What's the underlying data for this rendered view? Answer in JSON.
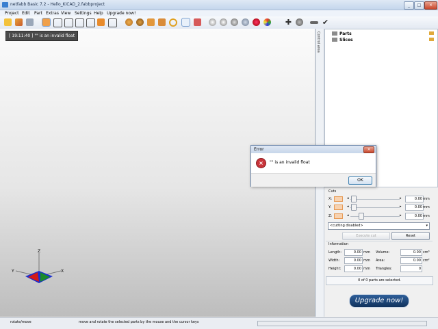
{
  "window": {
    "title": "netfabb Basic 7.2 - Hello_KiCAD_2.fabbproject",
    "controls": [
      "_",
      "□",
      "×"
    ]
  },
  "menu": [
    "Project",
    "Edit",
    "Part",
    "Extras",
    "View",
    "Settings",
    "Help",
    "Upgrade now!"
  ],
  "toolbar": {
    "icons": [
      "open-folder-icon",
      "open-part-icon",
      "save-icon",
      "view-cube-1-icon",
      "view-cube-2-icon",
      "view-cube-3-icon",
      "view-cube-4-icon",
      "view-cube-5-icon",
      "view-cube-6-icon",
      "view-cube-7-icon",
      "repair-icon",
      "measure-icon",
      "box-icon",
      "box-2-icon",
      "zoom-icon",
      "select-arrow-icon",
      "rotate-icon",
      "shading-1-icon",
      "shading-2-icon",
      "shading-3-icon",
      "shading-4-icon",
      "shading-5-icon",
      "color-icon",
      "add-part-icon",
      "camera-icon",
      "minus-icon",
      "check-icon"
    ]
  },
  "viewport": {
    "error_tip": "[ 19:11:40 ] \"\" is an invalid float",
    "axis_labels": {
      "x": "X",
      "y": "Y",
      "z": "Z"
    }
  },
  "control_area_label": "Control area",
  "tree": {
    "items": [
      {
        "label": "Parts"
      },
      {
        "label": "Slices"
      }
    ]
  },
  "cuts": {
    "title": "Cuts",
    "rows": [
      {
        "axis": "X:",
        "value": "0.00",
        "unit": "mm"
      },
      {
        "axis": "Y:",
        "value": "0.00",
        "unit": "mm"
      },
      {
        "axis": "Z:",
        "value": "0.00",
        "unit": "mm"
      }
    ],
    "mode_select": "<cutting disabled>",
    "execute_label": "Execute cut",
    "reset_label": "Reset"
  },
  "information": {
    "title": "Information",
    "length": {
      "label": "Length:",
      "value": "0.00",
      "unit": "mm"
    },
    "width": {
      "label": "Width:",
      "value": "0.00",
      "unit": "mm"
    },
    "height": {
      "label": "Height:",
      "value": "0.00",
      "unit": "mm"
    },
    "volume": {
      "label": "Volume:",
      "value": "0.00",
      "unit": "cm³"
    },
    "area": {
      "label": "Area:",
      "value": "0.00",
      "unit": "cm²"
    },
    "triangles": {
      "label": "Triangles:",
      "value": "0"
    }
  },
  "selection_status": "0 of 0 parts are selected.",
  "upgrade_button": "Upgrade now!",
  "statusbar": {
    "mode": "rotate/move",
    "hint": "move and rotate the selected parts by the mouse and the cursor keys"
  },
  "dialog": {
    "title": "Error",
    "message": "\"\" is an invalid float",
    "ok_label": "OK"
  },
  "colors": {
    "accent": "#3a7fd0",
    "error": "#c8343a",
    "upgrade_bg": "#0f315c"
  }
}
